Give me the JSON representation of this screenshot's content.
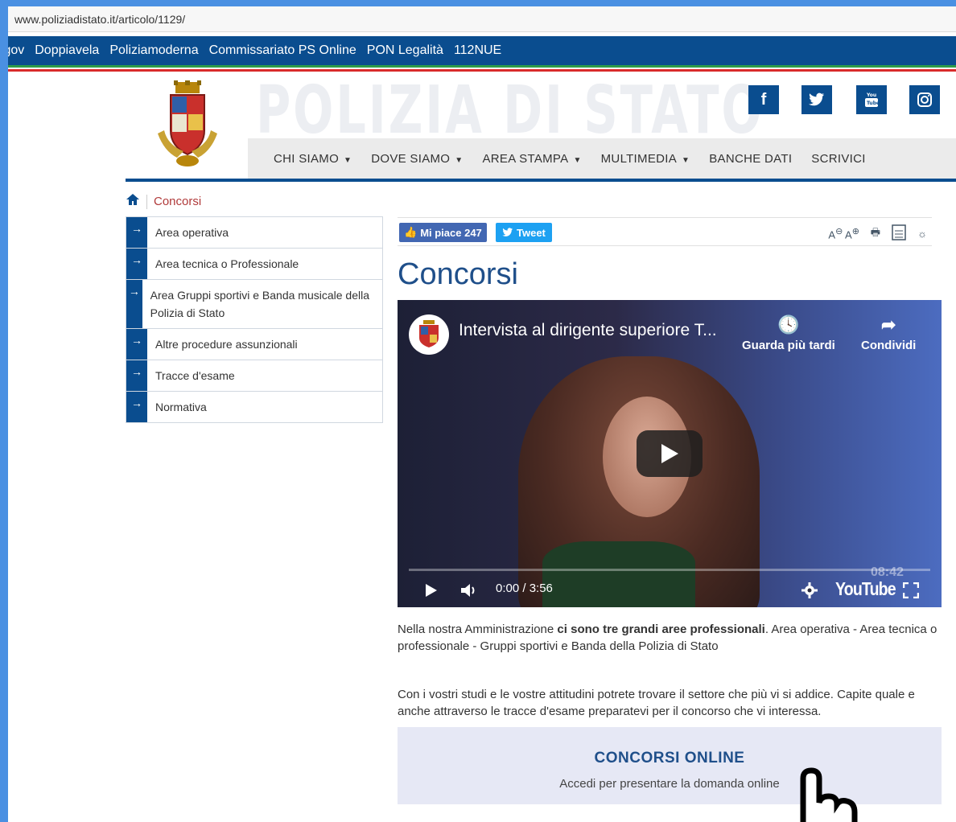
{
  "browser": {
    "url": "www.poliziadistato.it/articolo/1129/"
  },
  "topnav": {
    "links": [
      ".gov",
      "Doppiavela",
      "Poliziamoderna",
      "Commissariato PS Online",
      "PON Legalità",
      "112NUE"
    ]
  },
  "header": {
    "brand": "POLIZIA DI STATO",
    "social": [
      {
        "icon": "facebook-icon",
        "glyph": "f"
      },
      {
        "icon": "twitter-icon",
        "glyph": "t"
      },
      {
        "icon": "youtube-icon",
        "glyph": "yt"
      },
      {
        "icon": "instagram-icon",
        "glyph": "ig"
      }
    ],
    "menu": [
      {
        "label": "CHI SIAMO",
        "dropdown": true
      },
      {
        "label": "DOVE SIAMO",
        "dropdown": true
      },
      {
        "label": "AREA STAMPA",
        "dropdown": true
      },
      {
        "label": "MULTIMEDIA",
        "dropdown": true
      },
      {
        "label": "BANCHE DATI",
        "dropdown": false
      },
      {
        "label": "SCRIVICI",
        "dropdown": false
      }
    ]
  },
  "breadcrumb": {
    "current": "Concorsi"
  },
  "sidebar": {
    "items": [
      {
        "label": "Area operativa"
      },
      {
        "label": "Area tecnica o Professionale"
      },
      {
        "label": "Area Gruppi sportivi e Banda musicale della Polizia di Stato"
      },
      {
        "label": "Altre procedure assunzionali"
      },
      {
        "label": "Tracce d'esame"
      },
      {
        "label": "Normativa"
      }
    ]
  },
  "social_bar": {
    "like_label": "Mi piace 247",
    "tweet_label": "Tweet"
  },
  "main": {
    "title": "Concorsi",
    "video": {
      "title": "Intervista al dirigente superiore T...",
      "watch_later": "Guarda più tardi",
      "share": "Condividi",
      "time": "0:00 / 3:56",
      "platform": "YouTube",
      "stamp": "08:42"
    },
    "para1_a": "Nella nostra Amministrazione ",
    "para1_b": "ci sono tre grandi aree professionali",
    "para1_c": ". Area operativa - Area tecnica o professionale - Gruppi sportivi e Banda della Polizia di Stato",
    "para2": "Con i vostri studi e le vostre attitudini potrete trovare il settore che più vi si addice. Capite quale e anche attraverso le tracce d'esame preparatevi per il concorso che vi interessa.",
    "cta": {
      "title": "CONCORSI ONLINE",
      "subtitle": "Accedi per presentare la domanda online"
    }
  },
  "colors": {
    "primary": "#0a4d8f",
    "title": "#1f4f8a",
    "crumb": "#b03a3a",
    "cta_bg": "#e6e8f5"
  }
}
